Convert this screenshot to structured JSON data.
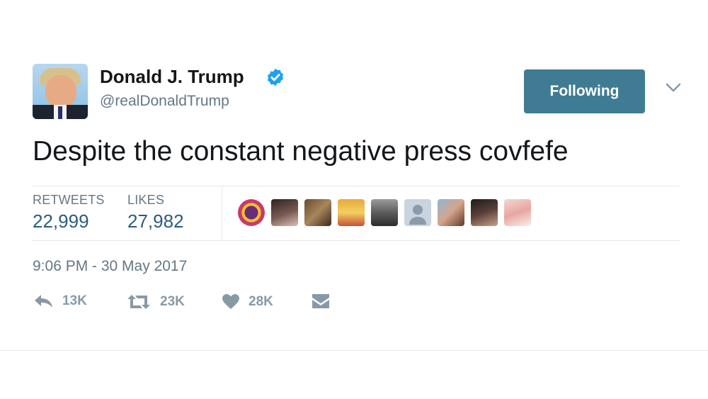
{
  "user": {
    "name": "Donald J. Trump",
    "handle": "@realDonaldTrump",
    "verified": true
  },
  "follow_button": {
    "label": "Following"
  },
  "tweet": {
    "text": "Despite the constant negative press covfefe"
  },
  "stats": {
    "retweets_label": "RETWEETS",
    "retweets_value": "22,999",
    "likes_label": "LIKES",
    "likes_value": "27,982"
  },
  "timestamp": "9:06 PM - 30 May 2017",
  "actions": {
    "reply_count": "13K",
    "retweet_count": "23K",
    "like_count": "28K"
  },
  "colors": {
    "follow_button_bg": "#3f7c93",
    "stat_value": "#2b5d7a",
    "verified_badge": "#1da1f2",
    "muted_text": "#657786",
    "action_icon": "#8899a6"
  },
  "likers": [
    "liker-avatar-1",
    "liker-avatar-2",
    "liker-avatar-3",
    "liker-avatar-4",
    "liker-avatar-5",
    "liker-avatar-6",
    "liker-avatar-7",
    "liker-avatar-8",
    "liker-avatar-9"
  ]
}
